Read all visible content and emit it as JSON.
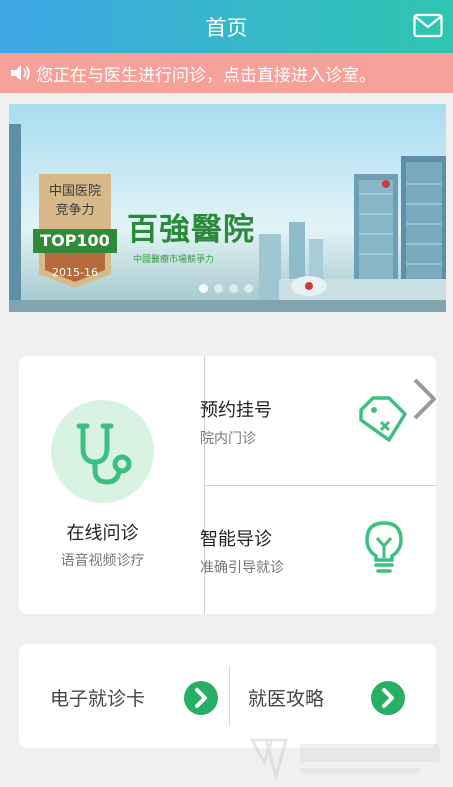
{
  "header": {
    "title": "首页"
  },
  "notice": {
    "text": "您正在与医生进行问诊，点击直接进入诊室。"
  },
  "banner": {
    "badge_line1": "中国医院",
    "badge_line2": "竞争力",
    "badge_rank": "TOP100",
    "badge_year": "2015-16",
    "hospital_name": "百強醫院",
    "hospital_subtitle": "中國醫療市場競爭力",
    "page_count": 4,
    "active_page": 1
  },
  "services": {
    "online": {
      "title": "在线问诊",
      "subtitle": "语音视频诊疗"
    },
    "register": {
      "title": "预约挂号",
      "subtitle": "院内门诊"
    },
    "guide": {
      "title": "智能导诊",
      "subtitle": "准确引导就诊"
    }
  },
  "quick": {
    "card": {
      "label": "电子就诊卡"
    },
    "strategy": {
      "label": "就医攻略"
    }
  },
  "colors": {
    "header_start": "#3ea7e6",
    "header_end": "#2ec6b0",
    "notice_bg": "#f5a098",
    "accent_green": "#27b063",
    "icon_green": "#3cbf80"
  }
}
